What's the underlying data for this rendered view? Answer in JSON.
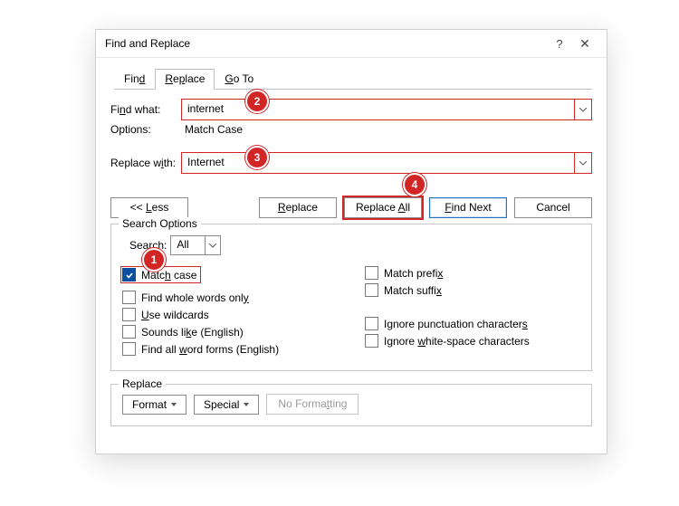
{
  "window": {
    "title": "Find and Replace",
    "help": "?",
    "close": "✕"
  },
  "tabs": {
    "find": "Find",
    "replace": "Replace",
    "goto": "Go To"
  },
  "find": {
    "label_prefix": "Fi",
    "label_ul": "n",
    "label_suffix": "d what:",
    "value": "internet",
    "options_label": "Options:",
    "options_value": "Match Case"
  },
  "replace_with": {
    "label_prefix": "Replace w",
    "label_ul": "i",
    "label_suffix": "th:",
    "value": "Internet"
  },
  "buttons": {
    "less": "<< Less",
    "replace": "Replace",
    "replace_all": "Replace All",
    "find_next": "Find Next",
    "cancel": "Cancel"
  },
  "search_options": {
    "legend": "Search Options",
    "search_label": "Search:",
    "search_value": "All",
    "left": {
      "match_case": "Match case",
      "whole_words": "Find whole words only",
      "use_wildcards": "Use wildcards",
      "sounds_like": "Sounds like (English)",
      "word_forms": "Find all word forms (English)"
    },
    "right": {
      "match_prefix": "Match prefix",
      "match_suffix": "Match suffix",
      "ignore_punct": "Ignore punctuation characters",
      "ignore_white": "Ignore white-space characters"
    }
  },
  "replace_section": {
    "legend": "Replace",
    "format": "Format",
    "special": "Special",
    "no_formatting": "No Formatting"
  },
  "markers": {
    "m1": "1",
    "m2": "2",
    "m3": "3",
    "m4": "4"
  }
}
